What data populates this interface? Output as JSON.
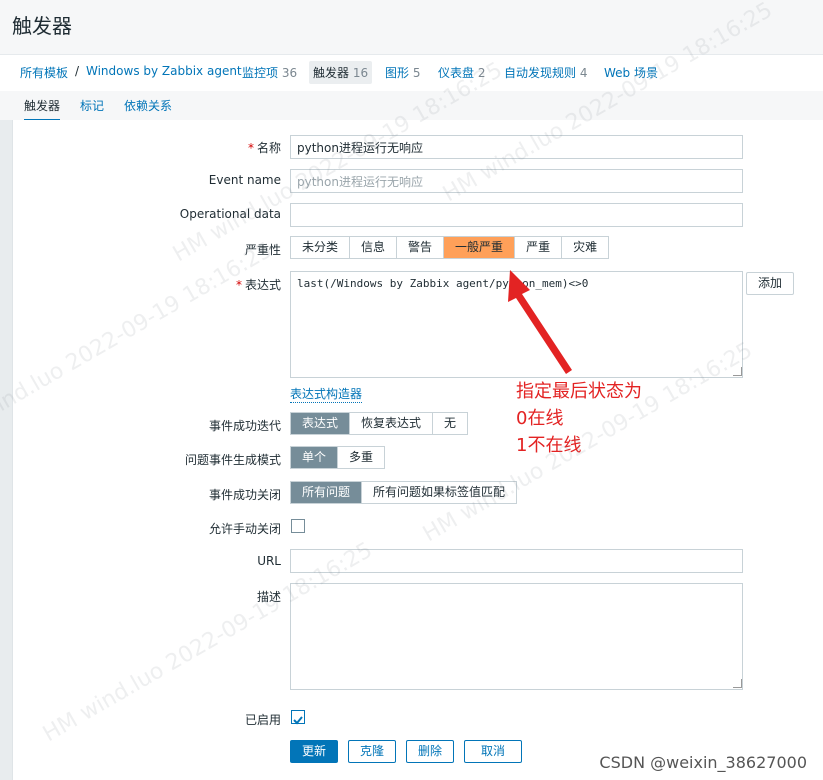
{
  "page": {
    "title": "触发器"
  },
  "breadcrumb": [
    {
      "label": "所有模板"
    },
    {
      "label": "Windows by Zabbix agent"
    },
    {
      "label": "监控项",
      "count": "36"
    },
    {
      "label": "触发器",
      "count": "16"
    },
    {
      "label": "图形",
      "count": "5"
    },
    {
      "label": "仪表盘",
      "count": "2"
    },
    {
      "label": "自动发现规则",
      "count": "4"
    },
    {
      "label": "Web 场景"
    }
  ],
  "tabs": [
    "触发器",
    "标记",
    "依赖关系"
  ],
  "form": {
    "name_label": "名称",
    "name_value": "python进程运行无响应",
    "event_name_label": "Event name",
    "event_name_placeholder": "python进程运行无响应",
    "opdata_label": "Operational data",
    "severity_label": "严重性",
    "severity_options": [
      "未分类",
      "信息",
      "警告",
      "一般严重",
      "严重",
      "灾难"
    ],
    "severity_selected": "一般严重",
    "expression_label": "表达式",
    "expression_value": "last(/Windows by Zabbix agent/python_mem)<>0",
    "add_button": "添加",
    "expression_builder_link": "表达式构造器",
    "ok_event_gen_label": "事件成功迭代",
    "ok_event_gen_options": [
      "表达式",
      "恢复表达式",
      "无"
    ],
    "ok_event_gen_selected": "表达式",
    "problem_mode_label": "问题事件生成模式",
    "problem_mode_options": [
      "单个",
      "多重"
    ],
    "problem_mode_selected": "单个",
    "ok_close_label": "事件成功关闭",
    "ok_close_options": [
      "所有问题",
      "所有问题如果标签值匹配"
    ],
    "ok_close_selected": "所有问题",
    "manual_close_label": "允许手动关闭",
    "url_label": "URL",
    "description_label": "描述",
    "enabled_label": "已启用",
    "buttons": {
      "update": "更新",
      "clone": "克隆",
      "delete": "删除",
      "cancel": "取消"
    }
  },
  "annotation": [
    "指定最后状态为",
    "0在线",
    "1不在线"
  ],
  "watermarks": [
    "HM wind.luo 2022-09-19 18:16:25"
  ],
  "csdn_credit": "CSDN @weixin_38627000",
  "colors": {
    "accent": "#0275b8",
    "severity_average": "#ffa059",
    "selected_grey": "#768d99",
    "annotation_red": "#e32323"
  }
}
